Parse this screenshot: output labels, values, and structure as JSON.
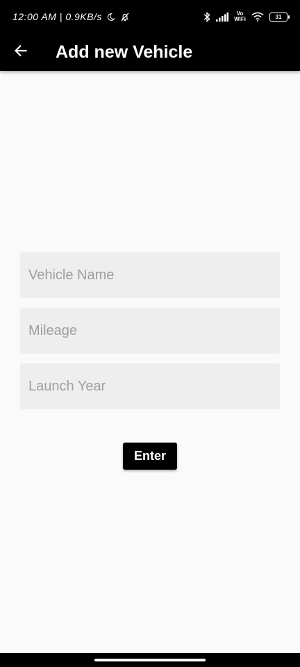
{
  "status_bar": {
    "time_network": "12:00 AM | 0.9KB/s",
    "vowifi_line1": "Vo",
    "vowifi_line2": "WiFi",
    "battery_level": "31",
    "icons": [
      "moon-icon",
      "alarm-off-icon",
      "bluetooth-icon",
      "signal-icon",
      "wifi-icon",
      "battery-icon"
    ]
  },
  "app_bar": {
    "title": "Add new Vehicle",
    "back_icon": "arrow-left-icon"
  },
  "form": {
    "vehicle_name": {
      "placeholder": "Vehicle Name",
      "value": ""
    },
    "mileage": {
      "placeholder": "Mileage",
      "value": ""
    },
    "launch_year": {
      "placeholder": "Launch Year",
      "value": ""
    }
  },
  "actions": {
    "enter_label": "Enter"
  },
  "colors": {
    "app_bar": "#000000",
    "background": "#fafafa",
    "field_fill": "#eeeeee",
    "placeholder": "#9e9e9e",
    "button": "#000000"
  }
}
